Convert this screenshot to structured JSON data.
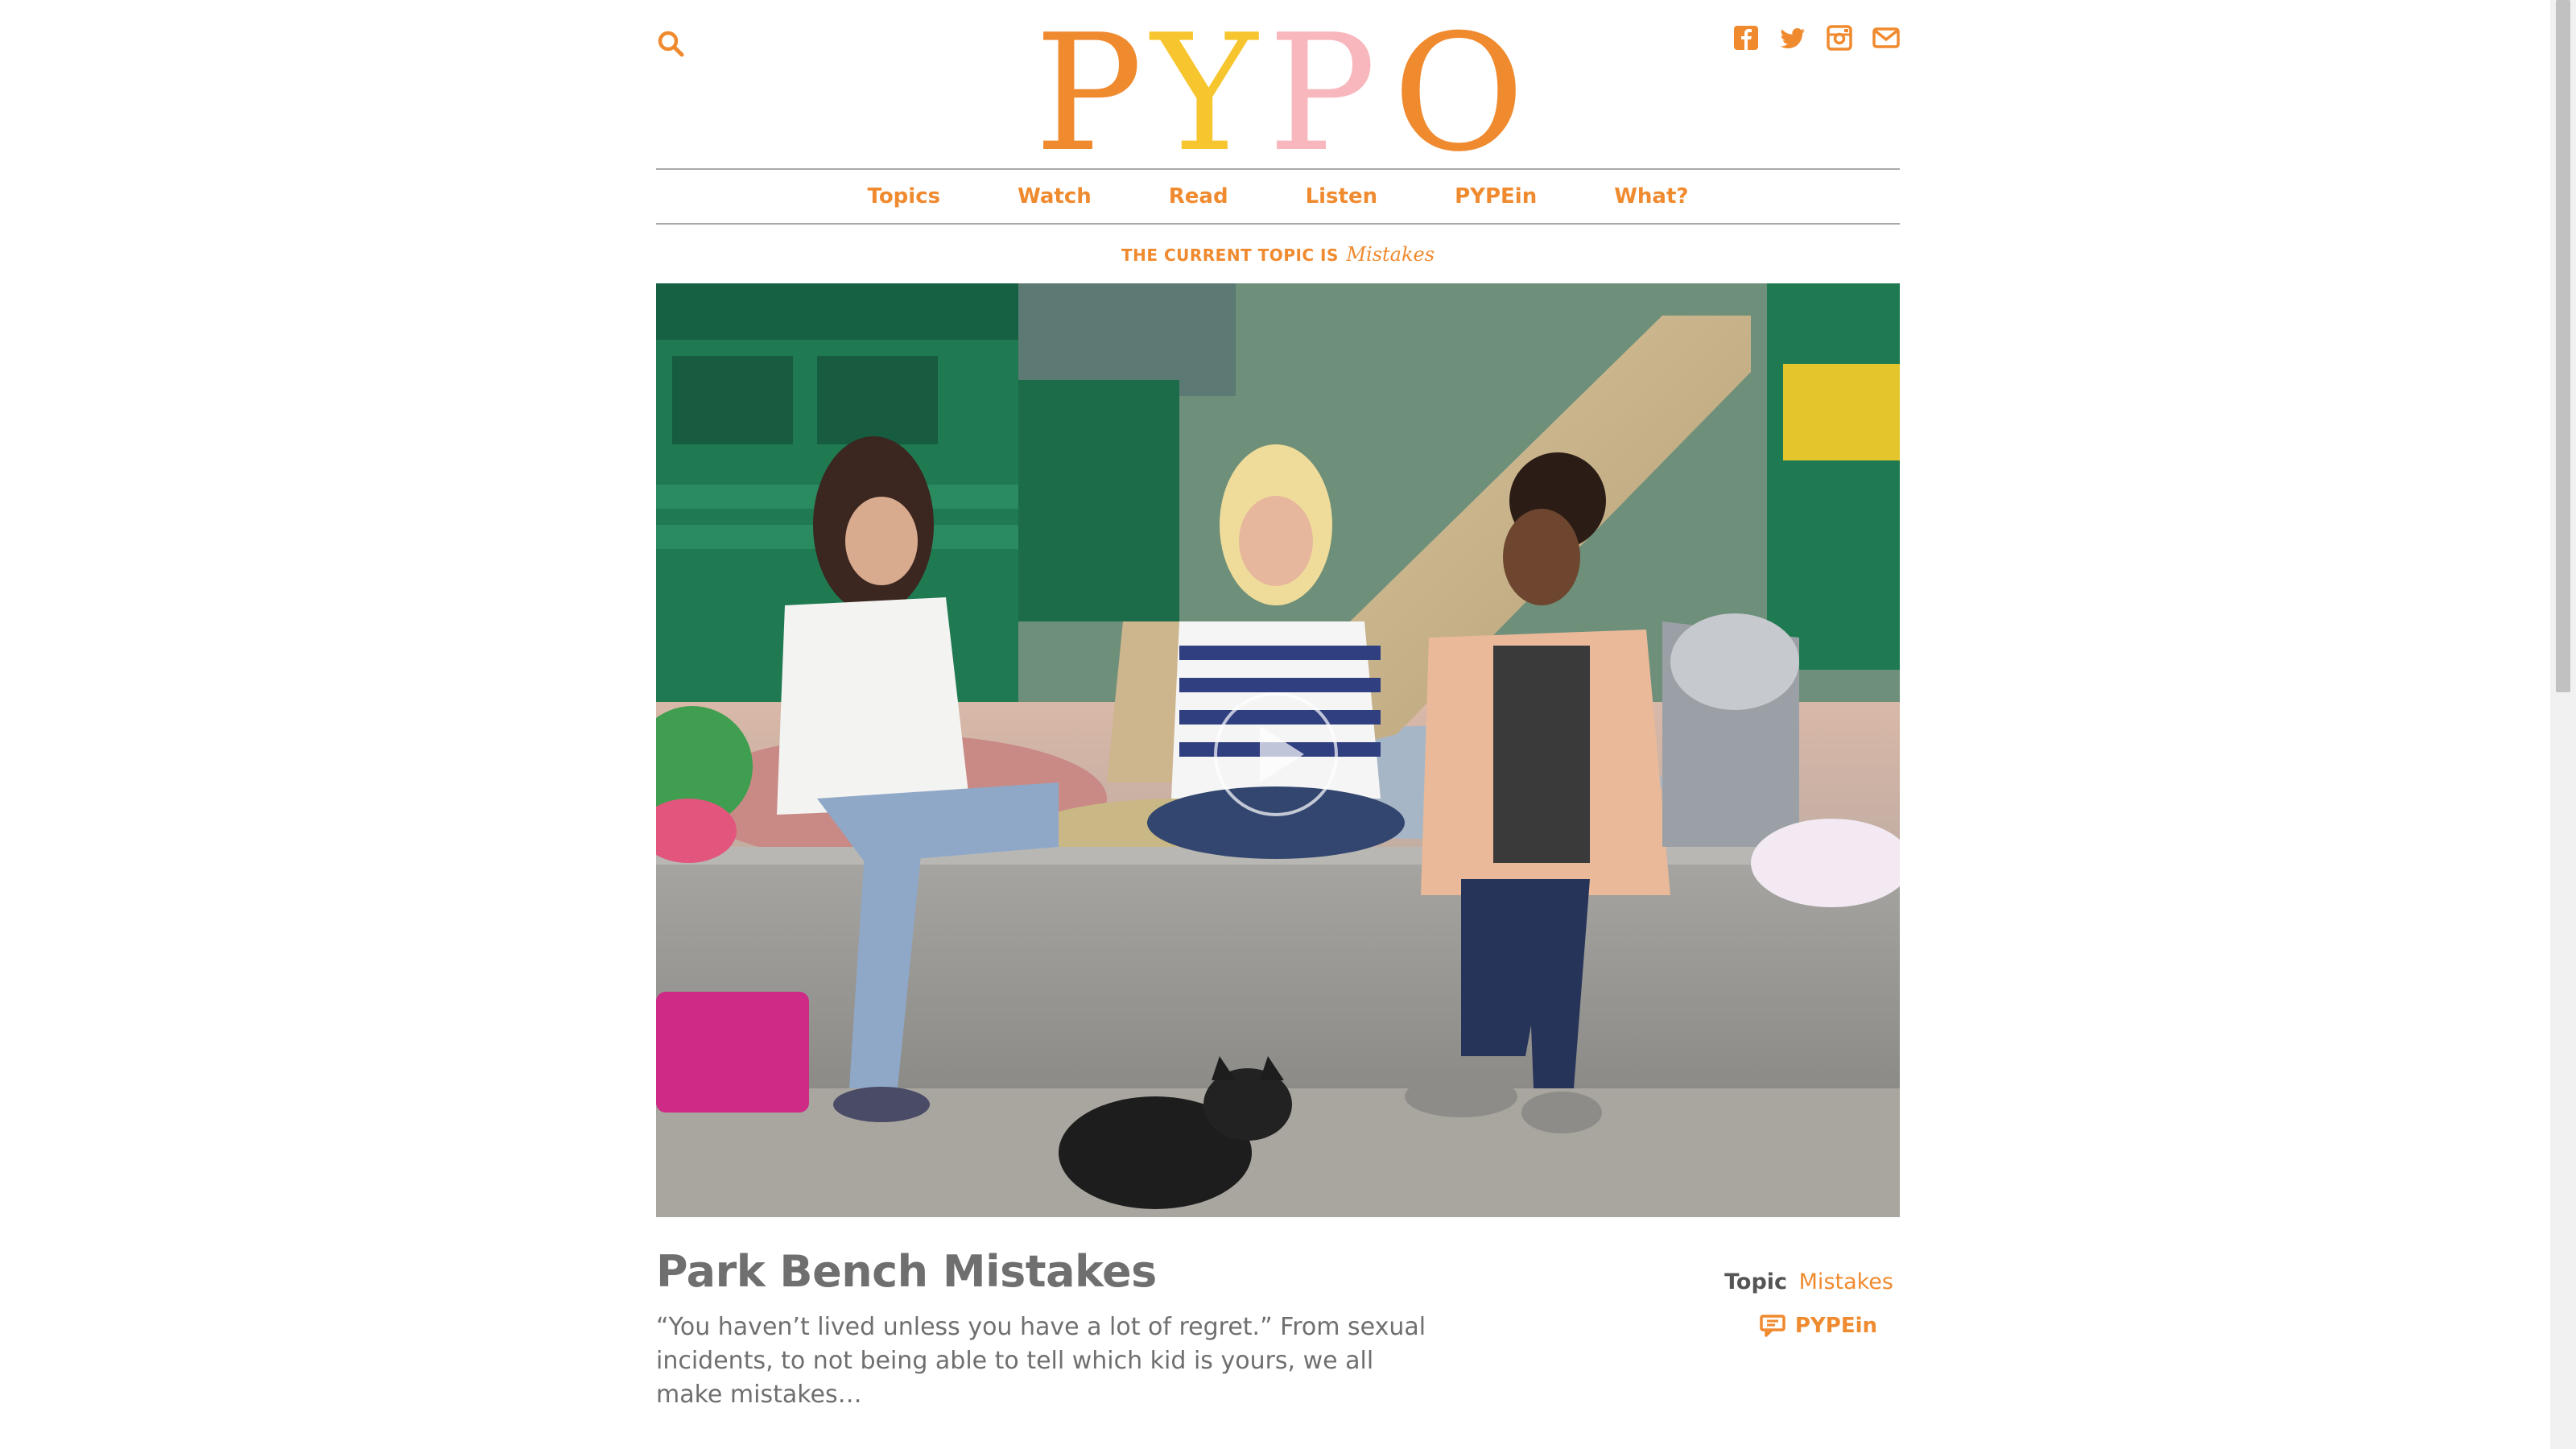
{
  "header": {
    "logo_text": "PYPO",
    "logo_colors": [
      "#f08a2f",
      "#f7c52e",
      "#f7b7bd",
      "#f08a2f",
      "#f7b7bd"
    ],
    "search_icon": "search-icon",
    "socials": [
      {
        "icon": "facebook-icon"
      },
      {
        "icon": "twitter-icon"
      },
      {
        "icon": "instagram-icon"
      },
      {
        "icon": "mail-icon"
      }
    ]
  },
  "nav": {
    "items": [
      {
        "label": "Topics"
      },
      {
        "label": "Watch"
      },
      {
        "label": "Read"
      },
      {
        "label": "Listen"
      },
      {
        "label": "PYPEin"
      },
      {
        "label": "What?"
      }
    ]
  },
  "current_topic": {
    "label": "THE CURRENT TOPIC IS",
    "value": "Mistakes"
  },
  "article": {
    "title": "Park Bench Mistakes",
    "excerpt": "“You haven’t lived unless you have a lot of regret.” From sexual incidents, to not being able to tell which kid is yours, we all make mistakes…",
    "topic_label": "Topic",
    "topic_value": "Mistakes",
    "type_label": "PYPEin",
    "type_icon": "chat-bubble-icon"
  },
  "theme": {
    "accent": "#f08a2f",
    "text": "#6f6f6f"
  }
}
